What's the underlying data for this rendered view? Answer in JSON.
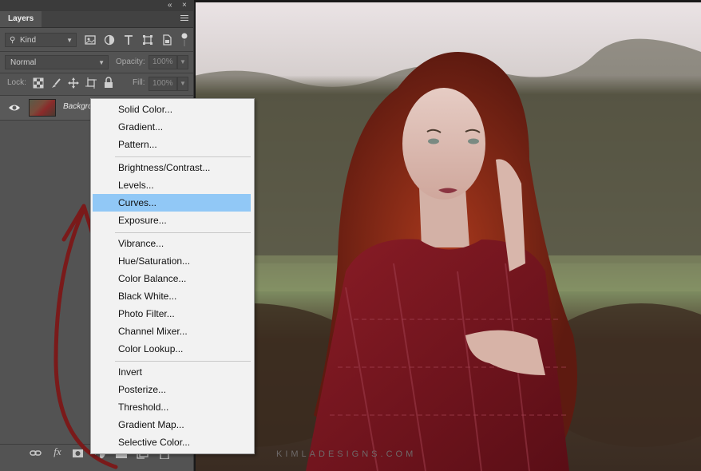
{
  "panel": {
    "tab_label": "Layers",
    "topbar": {
      "collapse_glyph": "«",
      "close_glyph": "×"
    },
    "filter": {
      "kind_label": "Kind",
      "icons": [
        "image-filter-icon",
        "adjustment-filter-icon",
        "type-filter-icon",
        "shape-filter-icon",
        "smart-object-filter-icon",
        "filter-toggle-icon"
      ]
    },
    "blend": {
      "mode": "Normal",
      "opacity_label": "Opacity:",
      "opacity_value": "100%"
    },
    "lock": {
      "label": "Lock:",
      "fill_label": "Fill:",
      "fill_value": "100%"
    },
    "layer": {
      "name": "Background"
    },
    "bottom_icons": [
      "link-layers-icon",
      "fx-icon",
      "add-mask-icon",
      "new-adjustment-layer-icon",
      "new-group-icon",
      "new-layer-icon",
      "trash-icon"
    ]
  },
  "canvas": {
    "watermark": "KIMLADESIGNS.COM"
  },
  "menu": {
    "items": [
      "Solid Color...",
      "Gradient...",
      "Pattern...",
      "Brightness/Contrast...",
      "Levels...",
      "Curves...",
      "Exposure...",
      "Vibrance...",
      "Hue/Saturation...",
      "Color Balance...",
      "Black  White...",
      "Photo Filter...",
      "Channel Mixer...",
      "Color Lookup...",
      "Invert",
      "Posterize...",
      "Threshold...",
      "Gradient Map...",
      "Selective Color..."
    ],
    "highlighted_item": "Curves..."
  },
  "colors": {
    "panel_bg": "#535353",
    "menu_bg": "#f2f2f2",
    "menu_highlight": "#91c8f6",
    "annotation_arrow": "#7a1a1a"
  }
}
